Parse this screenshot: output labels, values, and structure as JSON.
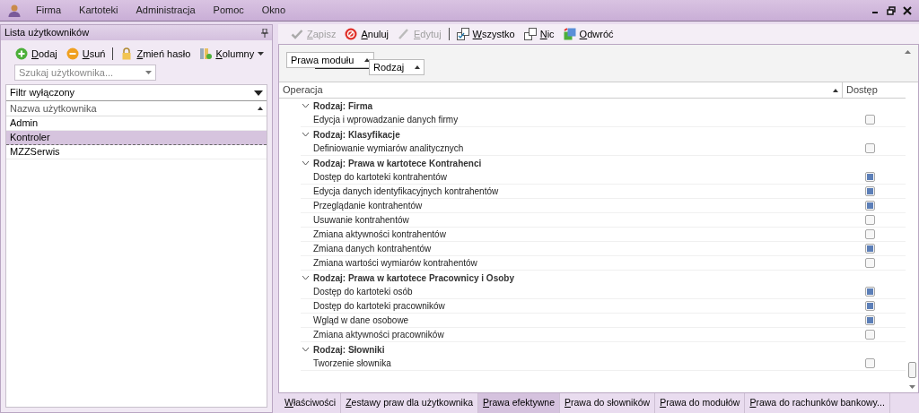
{
  "menu": [
    "Firma",
    "Kartoteki",
    "Administracja",
    "Pomoc",
    "Okno"
  ],
  "users_panel": {
    "title": "Lista użytkowników",
    "toolbar": [
      {
        "kind": "add",
        "label": "Dodaj",
        "disabled": false
      },
      {
        "kind": "remove",
        "label": "Usuń",
        "disabled": false
      },
      {
        "kind": "lock",
        "label": "Zmień hasło",
        "disabled": false
      },
      {
        "kind": "columns",
        "label": "Kolumny",
        "disabled": false
      }
    ],
    "search": {
      "placeholder": "Szukaj użytkownika..."
    },
    "filter": "Filtr wyłączony",
    "column": "Nazwa użytkownika",
    "users": [
      {
        "name": "Admin",
        "selected": false
      },
      {
        "name": "Kontroler",
        "selected": true
      },
      {
        "name": "MZZSerwis",
        "selected": false
      }
    ]
  },
  "rights_panel": {
    "toolbar": [
      {
        "kind": "save",
        "label": "Zapisz",
        "disabled": true
      },
      {
        "kind": "cancel",
        "label": "Anuluj",
        "disabled": false
      },
      {
        "kind": "edit",
        "label": "Edytuj",
        "disabled": true
      },
      {
        "kind": "all",
        "label": "Wszystko",
        "disabled": false
      },
      {
        "kind": "none",
        "label": "Nic",
        "disabled": false
      },
      {
        "kind": "invert",
        "label": "Odwróć",
        "disabled": false
      }
    ],
    "group_by": [
      "Prawa modułu",
      "Rodzaj"
    ],
    "columns": [
      "Operacja",
      "Dostęp"
    ],
    "groups": [
      {
        "label": "Rodzaj: Firma",
        "expanded": true,
        "children": [
          {
            "label": "Edycja i wprowadzanie danych firmy",
            "checked": false
          }
        ]
      },
      {
        "label": "Rodzaj: Klasyfikacje",
        "expanded": true,
        "children": [
          {
            "label": "Definiowanie wymiarów analitycznych",
            "checked": false
          }
        ]
      },
      {
        "label": "Rodzaj: Prawa w kartotece Kontrahenci",
        "expanded": true,
        "children": [
          {
            "label": "Dostęp do kartoteki kontrahentów",
            "checked": true
          },
          {
            "label": "Edycja danych identyfikacyjnych kontrahentów",
            "checked": true
          },
          {
            "label": "Przeglądanie kontrahentów",
            "checked": true
          },
          {
            "label": "Usuwanie kontrahentów",
            "checked": false
          },
          {
            "label": "Zmiana aktywności kontrahentów",
            "checked": false
          },
          {
            "label": "Zmiana danych kontrahentów",
            "checked": true
          },
          {
            "label": "Zmiana wartości wymiarów kontrahentów",
            "checked": false
          }
        ]
      },
      {
        "label": "Rodzaj: Prawa w kartotece Pracownicy i Osoby",
        "expanded": true,
        "children": [
          {
            "label": "Dostęp do kartoteki osób",
            "checked": true
          },
          {
            "label": "Dostęp do kartoteki pracowników",
            "checked": true
          },
          {
            "label": "Wgląd w dane osobowe",
            "checked": true
          },
          {
            "label": "Zmiana aktywności pracowników",
            "checked": false
          }
        ]
      },
      {
        "label": "Rodzaj: Słowniki",
        "expanded": true,
        "children": [
          {
            "label": "Tworzenie słownika",
            "checked": false
          }
        ]
      }
    ],
    "tabs": [
      {
        "label": "Właściwości",
        "selected": false
      },
      {
        "label": "Zestawy praw dla użytkownika",
        "selected": false
      },
      {
        "label": "Prawa efektywne",
        "selected": true
      },
      {
        "label": "Prawa do słowników",
        "selected": false
      },
      {
        "label": "Prawa do modułów",
        "selected": false
      },
      {
        "label": "Prawa do rachunków bankowy...",
        "selected": false
      }
    ]
  }
}
